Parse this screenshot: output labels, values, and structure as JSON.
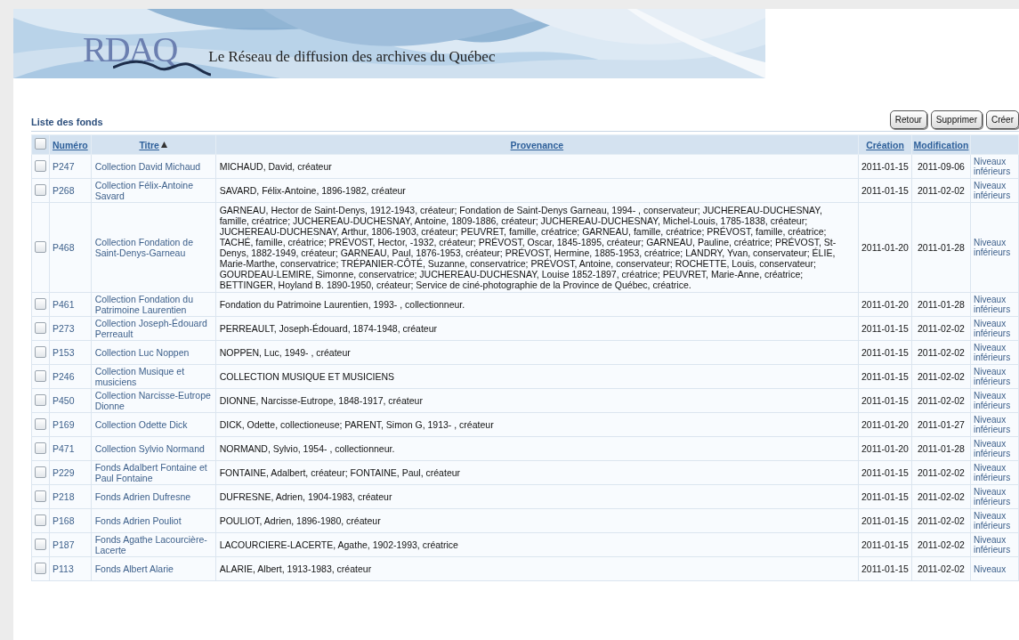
{
  "banner": {
    "logo": "RDAQ",
    "subtitle": "Le Réseau de diffusion des archives du Québec"
  },
  "list_title": "Liste des fonds",
  "buttons": [
    "Retour",
    "Supprimer",
    "Créer"
  ],
  "table": {
    "select_all": {
      "checked": false
    },
    "columns": [
      {
        "label": "Numéro",
        "sorted": false
      },
      {
        "label": "Titre",
        "sorted": true
      },
      {
        "label": "Provenance",
        "sorted": false
      },
      {
        "label": "Création",
        "sorted": false
      },
      {
        "label": "Modification",
        "sorted": false
      }
    ],
    "rows": [
      {
        "selected": false,
        "number": "P247",
        "title": "Collection David Michaud",
        "provenance": "MICHAUD, David, créateur",
        "created": "2011-01-15",
        "modified": "2011-09-06",
        "link": "Niveaux inférieurs"
      },
      {
        "selected": false,
        "number": "P268",
        "title": "Collection Félix-Antoine Savard",
        "provenance": "SAVARD, Félix-Antoine, 1896-1982, créateur",
        "created": "2011-01-15",
        "modified": "2011-02-02",
        "link": "Niveaux inférieurs"
      },
      {
        "selected": false,
        "number": "P468",
        "title": "Collection Fondation de Saint-Denys-Garneau",
        "provenance": "GARNEAU, Hector de Saint-Denys, 1912-1943, créateur; Fondation de Saint-Denys Garneau, 1994- , conservateur; JUCHEREAU-DUCHESNAY, famille, créatrice; JUCHEREAU-DUCHESNAY, Antoine, 1809-1886, créateur; JUCHEREAU-DUCHESNAY, Michel-Louis, 1785-1838, créateur; JUCHEREAU-DUCHESNAY, Arthur, 1806-1903, créateur; PEUVRET, famille, créatrice; GARNEAU, famille, créatrice; PRÉVOST, famille, créatrice; TACHÉ, famille, créatrice; PRÉVOST, Hector, -1932, créateur; PRÉVOST, Oscar, 1845-1895, créateur; GARNEAU, Pauline, créatrice; PRÉVOST, St-Denys, 1882-1949, créateur; GARNEAU, Paul, 1876-1953, créateur; PRÉVOST, Hermine, 1885-1953, créatrice; LANDRY, Yvan, conservateur; ÉLIE, Marie-Marthe, conservatrice; TRÉPANIER-CÔTÉ, Suzanne, conservatrice; PRÉVOST, Antoine, conservateur; ROCHETTE, Louis, conservateur; GOURDEAU-LEMIRE, Simonne, conservatrice; JUCHEREAU-DUCHESNAY, Louise 1852-1897, créatrice; PEUVRET, Marie-Anne, créatrice; BETTINGER, Hoyland B. 1890-1950, créateur; Service de ciné-photographie de la Province de Québec, créatrice.",
        "created": "2011-01-20",
        "modified": "2011-01-28",
        "link": "Niveaux inférieurs"
      },
      {
        "selected": false,
        "number": "P461",
        "title": "Collection Fondation du Patrimoine Laurentien",
        "provenance": "Fondation du Patrimoine Laurentien, 1993- , collectionneur.",
        "created": "2011-01-20",
        "modified": "2011-01-28",
        "link": "Niveaux inférieurs"
      },
      {
        "selected": false,
        "number": "P273",
        "title": "Collection Joseph-Édouard Perreault",
        "provenance": "PERREAULT, Joseph-Édouard, 1874-1948, créateur",
        "created": "2011-01-15",
        "modified": "2011-02-02",
        "link": "Niveaux inférieurs"
      },
      {
        "selected": false,
        "number": "P153",
        "title": "Collection Luc Noppen",
        "provenance": "NOPPEN, Luc, 1949- , créateur",
        "created": "2011-01-15",
        "modified": "2011-02-02",
        "link": "Niveaux inférieurs"
      },
      {
        "selected": false,
        "number": "P246",
        "title": "Collection Musique et musiciens",
        "provenance": "COLLECTION MUSIQUE ET MUSICIENS",
        "created": "2011-01-15",
        "modified": "2011-02-02",
        "link": "Niveaux inférieurs"
      },
      {
        "selected": false,
        "number": "P450",
        "title": "Collection Narcisse-Eutrope Dionne",
        "provenance": "DIONNE, Narcisse-Eutrope, 1848-1917, créateur",
        "created": "2011-01-15",
        "modified": "2011-02-02",
        "link": "Niveaux inférieurs"
      },
      {
        "selected": false,
        "number": "P169",
        "title": "Collection Odette Dick",
        "provenance": "DICK, Odette, collectioneuse; PARENT, Simon G, 1913- , créateur",
        "created": "2011-01-20",
        "modified": "2011-01-27",
        "link": "Niveaux inférieurs"
      },
      {
        "selected": false,
        "number": "P471",
        "title": "Collection Sylvio Normand",
        "provenance": "NORMAND, Sylvio, 1954- , collectionneur.",
        "created": "2011-01-20",
        "modified": "2011-01-28",
        "link": "Niveaux inférieurs"
      },
      {
        "selected": false,
        "number": "P229",
        "title": "Fonds Adalbert Fontaine et Paul Fontaine",
        "provenance": "FONTAINE, Adalbert, créateur; FONTAINE, Paul, créateur",
        "created": "2011-01-15",
        "modified": "2011-02-02",
        "link": "Niveaux inférieurs"
      },
      {
        "selected": false,
        "number": "P218",
        "title": "Fonds Adrien Dufresne",
        "provenance": "DUFRESNE, Adrien, 1904-1983, créateur",
        "created": "2011-01-15",
        "modified": "2011-02-02",
        "link": "Niveaux inférieurs"
      },
      {
        "selected": false,
        "number": "P168",
        "title": "Fonds Adrien Pouliot",
        "provenance": "POULIOT, Adrien, 1896-1980, créateur",
        "created": "2011-01-15",
        "modified": "2011-02-02",
        "link": "Niveaux inférieurs"
      },
      {
        "selected": false,
        "number": "P187",
        "title": "Fonds Agathe Lacourcière-Lacerte",
        "provenance": "LACOURCIERE-LACERTE, Agathe, 1902-1993, créatrice",
        "created": "2011-01-15",
        "modified": "2011-02-02",
        "link": "Niveaux inférieurs"
      },
      {
        "selected": false,
        "number": "P113",
        "title": "Fonds Albert Alarie",
        "provenance": "ALARIE, Albert, 1913-1983, créateur",
        "created": "2011-01-15",
        "modified": "2011-02-02",
        "link": "Niveaux"
      }
    ]
  }
}
